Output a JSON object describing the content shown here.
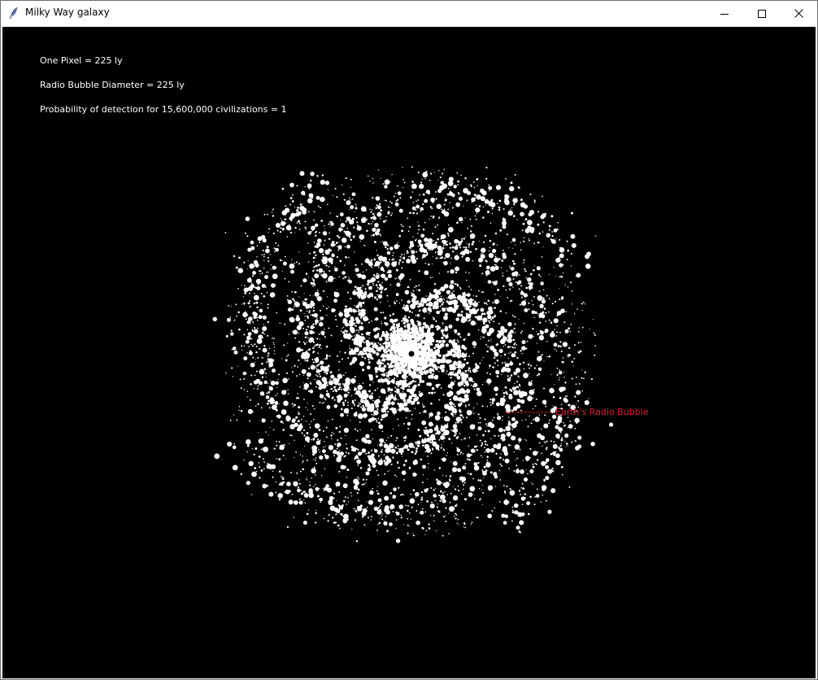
{
  "window": {
    "title": "Milky Way galaxy",
    "icon": "feather-icon",
    "controls": {
      "minimize": "minimize-icon",
      "maximize": "maximize-icon",
      "close": "close-icon"
    }
  },
  "info": {
    "pixel_scale": "One Pixel = 225 ly",
    "bubble_diameter": "Radio Bubble Diameter = 225 ly",
    "detection_probability": "Probability of detection for 15,600,000 civilizations = 1"
  },
  "earth_marker": {
    "label": "Earth's Radio Bubble",
    "color": "#e8192c"
  },
  "colors": {
    "background": "#000000",
    "stars": "#ffffff"
  }
}
